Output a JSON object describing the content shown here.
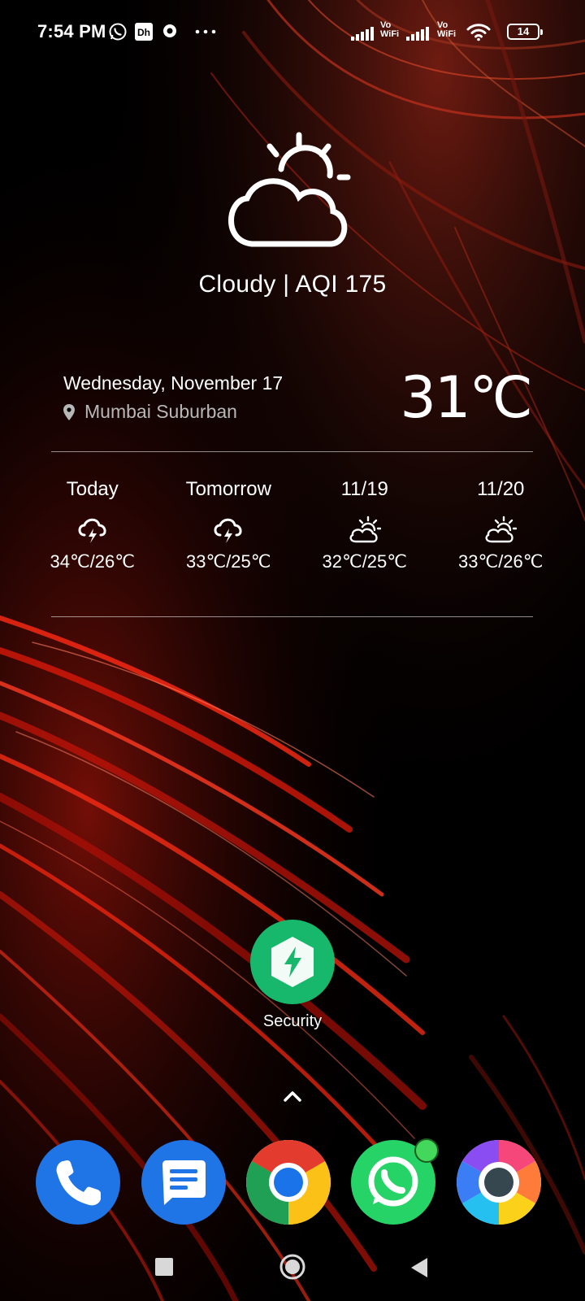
{
  "status_bar": {
    "time": "7:54 PM",
    "notification_icons": [
      "whatsapp-icon",
      "dailyhunt-icon",
      "app-notification-icon",
      "more-notifications-icon"
    ],
    "sim1_label_top": "Vo",
    "sim1_label_bottom": "WiFi",
    "sim2_label_top": "Vo",
    "sim2_label_bottom": "WiFi",
    "battery_level": "14"
  },
  "weather": {
    "condition": "Cloudy | AQI 175",
    "date": "Wednesday, November 17",
    "location": "Mumbai Suburban",
    "temperature": "31℃",
    "forecast": [
      {
        "label": "Today",
        "range": "34℃/26℃",
        "icon": "thunderstorm-icon"
      },
      {
        "label": "Tomorrow",
        "range": "33℃/25℃",
        "icon": "thunderstorm-icon"
      },
      {
        "label": "11/19",
        "range": "32℃/25℃",
        "icon": "partly-cloudy-icon"
      },
      {
        "label": "11/20",
        "range": "33℃/26℃",
        "icon": "partly-cloudy-icon"
      }
    ]
  },
  "home_apps": [
    {
      "label": "Security",
      "icon": "security-icon",
      "color": "#1bb76e"
    }
  ],
  "dock": [
    {
      "name": "phone-app",
      "icon": "phone-icon",
      "color": "#1e74e8"
    },
    {
      "name": "messages-app",
      "icon": "messages-icon",
      "color": "#1e74e8"
    },
    {
      "name": "chrome-app",
      "icon": "chrome-icon",
      "color": "#1a9a4a"
    },
    {
      "name": "whatsapp-app",
      "icon": "whatsapp-icon",
      "color": "#25d366"
    },
    {
      "name": "browser-app",
      "icon": "browser-icon",
      "color": "#ff6f3c"
    }
  ],
  "nav_bar": [
    "recents-button",
    "home-button",
    "back-button"
  ]
}
